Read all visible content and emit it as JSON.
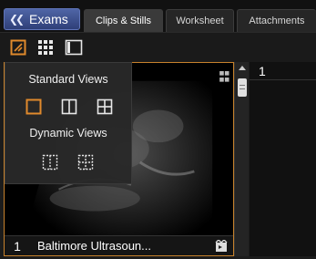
{
  "header": {
    "exams_label": "Exams",
    "tabs": [
      {
        "label": "Clips & Stills",
        "active": true
      },
      {
        "label": "Worksheet",
        "active": false
      },
      {
        "label": "Attachments",
        "active": false
      }
    ]
  },
  "toolbar": {
    "icons": [
      "layout-select-icon",
      "grid-icon",
      "panel-toggle-icon"
    ],
    "accent_color": "#e08a2c"
  },
  "layout_menu": {
    "standard_title": "Standard Views",
    "dynamic_title": "Dynamic Views",
    "standard_views": [
      "single-view-icon",
      "two-column-view-icon",
      "four-grid-view-icon"
    ],
    "dynamic_views": [
      "dynamic-two-column-view-icon",
      "dynamic-four-grid-view-icon"
    ],
    "selected": "single-view-icon"
  },
  "viewer": {
    "index": "1",
    "title": "Baltimore Ultrasoun...",
    "border_color": "#c8822c"
  },
  "right_panel": {
    "index": "1"
  }
}
